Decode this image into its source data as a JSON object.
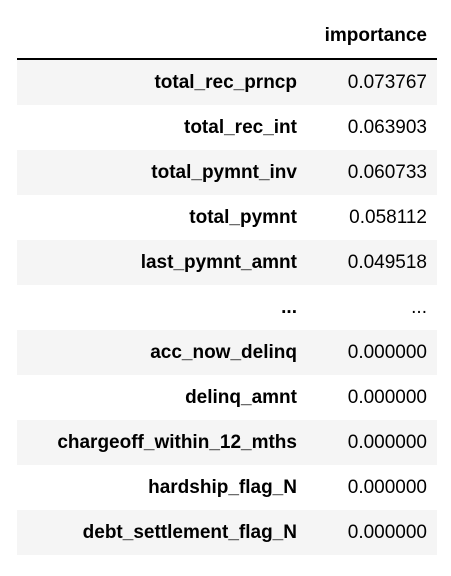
{
  "table": {
    "index_header": "",
    "column_header": "importance",
    "rows": [
      {
        "feature": "total_rec_prncp",
        "importance": "0.073767"
      },
      {
        "feature": "total_rec_int",
        "importance": "0.063903"
      },
      {
        "feature": "total_pymnt_inv",
        "importance": "0.060733"
      },
      {
        "feature": "total_pymnt",
        "importance": "0.058112"
      },
      {
        "feature": "last_pymnt_amnt",
        "importance": "0.049518"
      },
      {
        "feature": "...",
        "importance": "..."
      },
      {
        "feature": "acc_now_delinq",
        "importance": "0.000000"
      },
      {
        "feature": "delinq_amnt",
        "importance": "0.000000"
      },
      {
        "feature": "chargeoff_within_12_mths",
        "importance": "0.000000"
      },
      {
        "feature": "hardship_flag_N",
        "importance": "0.000000"
      },
      {
        "feature": "debt_settlement_flag_N",
        "importance": "0.000000"
      }
    ]
  }
}
